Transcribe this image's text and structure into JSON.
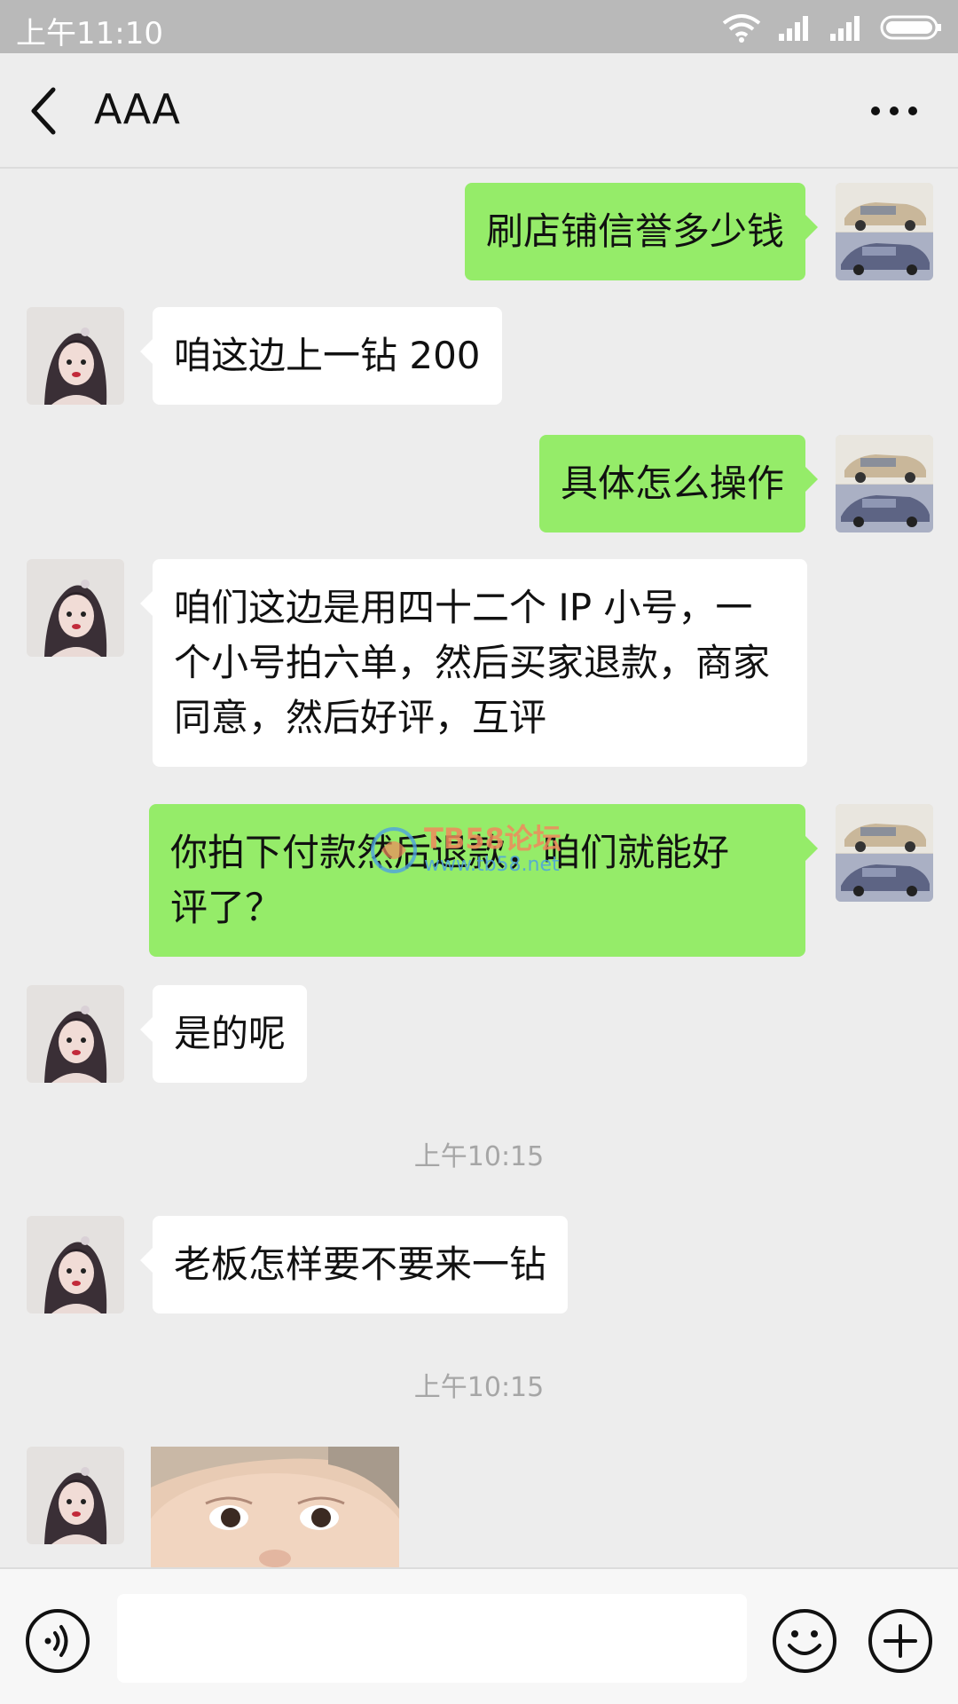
{
  "status_bar": {
    "time": "上午11:10",
    "icons": [
      "wifi-icon",
      "signal-icon",
      "signal-icon",
      "battery-icon"
    ]
  },
  "nav": {
    "title": "AAA",
    "back_icon": "chevron-left-icon",
    "more_icon": "more-dots-icon"
  },
  "messages": [
    {
      "sender": "me",
      "text": "刷店铺信誉多少钱"
    },
    {
      "sender": "contact",
      "text": "咱这边上一钻 200"
    },
    {
      "sender": "me",
      "text": "具体怎么操作"
    },
    {
      "sender": "contact",
      "lines": [
        "咱们这边是用四十二个 IP 小号，一",
        "个小号拍六单，然后买家退款，商家",
        "同意，然后好评，互评"
      ]
    },
    {
      "sender": "me",
      "lines": [
        "你拍下付款然后退款，咱们就能好",
        "评了？"
      ]
    },
    {
      "sender": "contact",
      "text": "是的呢"
    },
    {
      "type": "timestamp",
      "text": "上午10:15"
    },
    {
      "sender": "contact",
      "text": "老板怎样要不要来一钻"
    },
    {
      "type": "timestamp",
      "text": "上午10:15"
    },
    {
      "sender": "contact",
      "type": "image",
      "image": "baby-photo"
    }
  ],
  "watermark": {
    "title": "TB58论坛",
    "url": "www.tb58.net"
  },
  "input_bar": {
    "value": "",
    "voice_icon": "voice-icon",
    "emoji_icon": "emoji-icon",
    "plus_icon": "plus-icon"
  },
  "colors": {
    "background": "#ededed",
    "outgoing_bubble": "#95ec69",
    "incoming_bubble": "#ffffff",
    "status_bar": "#b9b9b9",
    "timestamp": "#a6a6a6"
  }
}
